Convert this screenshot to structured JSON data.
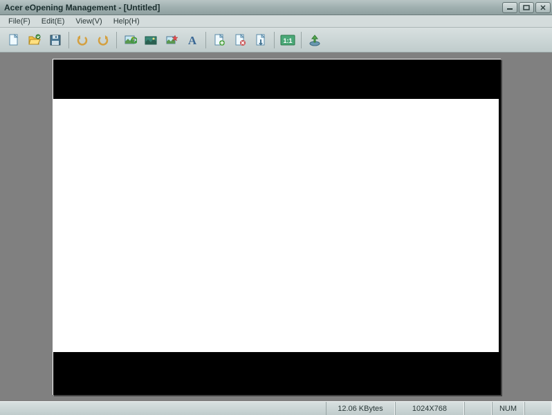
{
  "window": {
    "title": "Acer eOpening Management - [Untitled]"
  },
  "menubar": {
    "file": "File(F)",
    "edit": "Edit(E)",
    "view": "View(V)",
    "help": "Help(H)"
  },
  "toolbar": {
    "icons": {
      "new": "new-doc-icon",
      "open": "open-folder-icon",
      "save": "save-disk-icon",
      "undo": "undo-icon",
      "redo": "redo-icon",
      "image1": "image-refresh-icon",
      "image2": "image-landscape-icon",
      "image3": "image-star-icon",
      "text": "text-a-icon",
      "page_add": "page-add-icon",
      "page_del": "page-del-icon",
      "page_arrow": "page-arrow-icon",
      "ratio": "ratio-11-icon",
      "upload": "upload-icon"
    }
  },
  "statusbar": {
    "size": "12.06 KBytes",
    "resolution": "1024X768",
    "numlock": "NUM"
  }
}
